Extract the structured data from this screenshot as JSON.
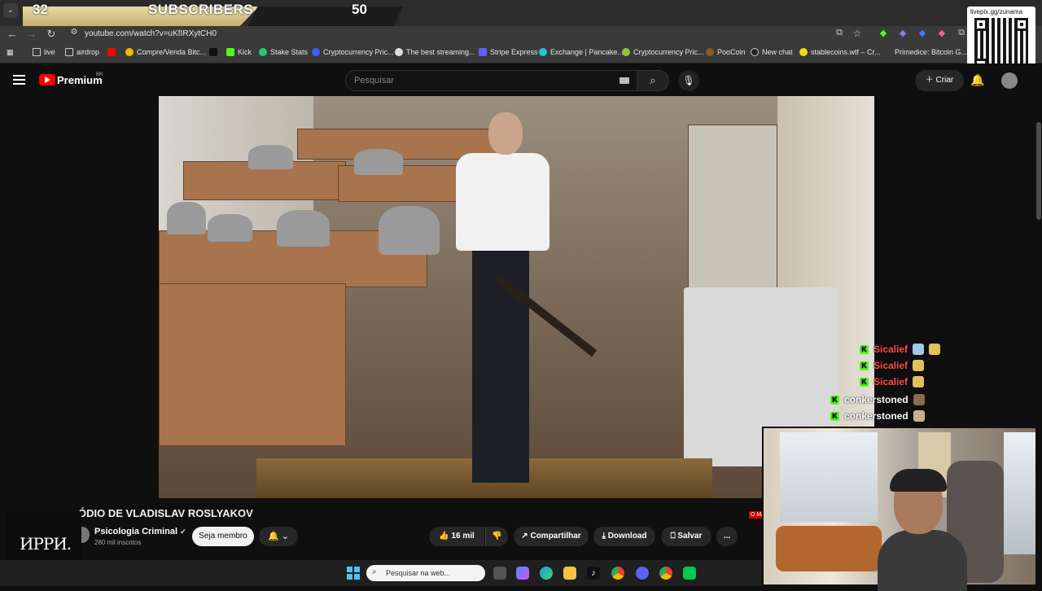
{
  "overlay": {
    "subs_count": "32",
    "subs_label": "SUBSCRIBERS",
    "subs_goal": "50"
  },
  "browser": {
    "url": "youtube.com/watch?v=uKfIRXytCH0",
    "bookmarks": [
      "live",
      "airdrop",
      "Compre/Venda Bitc...",
      "Kick",
      "Stake Stats",
      "Cryptocurrency Pric...",
      "The best streaming...",
      "Stripe Express",
      "Exchange | Pancake...",
      "Cryptocurrency Pric...",
      "PooCoin",
      "New chat",
      "stablecoins.wtf – Cr...",
      "Primedice: Bitcoin G..."
    ]
  },
  "youtube": {
    "logo_text": "Premium",
    "region": "BR",
    "search_placeholder": "Pesquisar",
    "create_label": "Criar",
    "video_title": "ÓDIO DE VLADISLAV ROSLYAKOV",
    "channel_name": "Psicologia Criminal",
    "subscribers": "280 mil inscritos",
    "member_label": "Seja membro",
    "likes": "16 mil",
    "share_label": "Compartilhar",
    "download_label": "Download",
    "save_label": "Salvar",
    "more_label": "...",
    "overlay_tag": "O MA"
  },
  "qr": {
    "label": "livepix.gg/zunama"
  },
  "chat": [
    {
      "user": "Sicalief",
      "color": "#ff4d4d"
    },
    {
      "user": "Sicalief",
      "color": "#ff4d4d"
    },
    {
      "user": "Sicalief",
      "color": "#ff4d4d"
    },
    {
      "user": "conkerstoned",
      "color": "#ffffff"
    },
    {
      "user": "conkerstoned",
      "color": "#ffffff"
    }
  ],
  "stream_logo": {
    "text": "ИРРИ."
  },
  "taskbar": {
    "search_placeholder": "Pesquisar na web..."
  },
  "colors": {
    "youtube_red": "#ff0000",
    "kick_green": "#53fc18",
    "gold": "#e9d9a8"
  }
}
